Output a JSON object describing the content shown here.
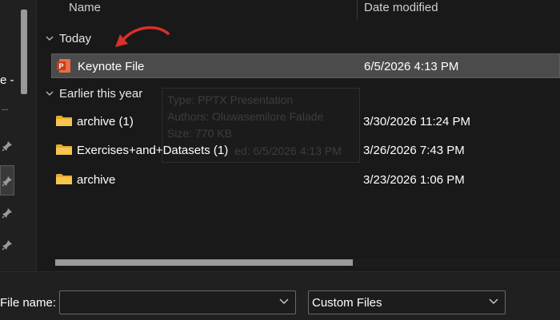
{
  "nav": {
    "partial_label": "e -"
  },
  "columns": {
    "name": "Name",
    "date_modified": "Date modified"
  },
  "groups": [
    {
      "label": "Today"
    },
    {
      "label": "Earlier this year"
    }
  ],
  "files": [
    {
      "name": "Keynote File",
      "date": "6/5/2026 4:13 PM",
      "icon": "pptx-file-icon",
      "selected": true
    },
    {
      "name": "archive (1)",
      "date": "3/30/2026 11:24 PM",
      "icon": "folder-icon"
    },
    {
      "name": "Exercises+and+Datasets (1)",
      "date": "3/26/2026 7:43 PM",
      "icon": "folder-icon"
    },
    {
      "name": "archive",
      "date": "3/23/2026 1:06 PM",
      "icon": "folder-icon"
    }
  ],
  "tooltip": {
    "type": "Type: PPTX Presentation",
    "authors": "Authors: Oluwasemilore Falade",
    "size": "Size: 770 KB",
    "modified": "ed: 6/5/2026 4:13 PM"
  },
  "footer": {
    "file_name_label": "File name:",
    "file_name_value": "",
    "filter_value": "Custom Files"
  },
  "colors": {
    "background": "#191919",
    "selected_row": "#4b4b4b",
    "pptx_orange": "#d04423",
    "folder_yellow": "#f2c04a",
    "arrow_red": "#d9302a"
  }
}
